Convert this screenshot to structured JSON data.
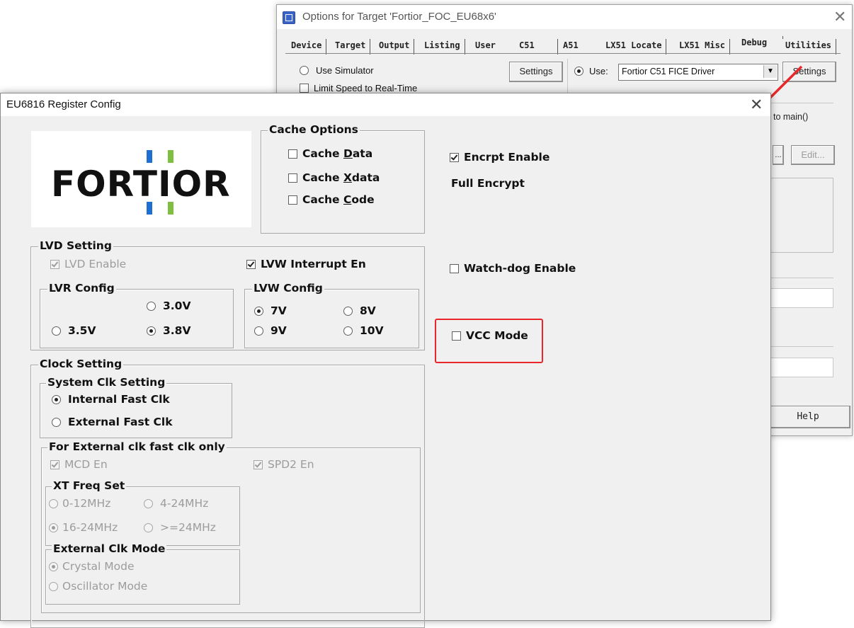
{
  "background_window": {
    "title": "Options for Target 'Fortior_FOC_EU68x6'",
    "tabs": [
      "Device",
      "Target",
      "Output",
      "Listing",
      "User",
      "C51",
      "A51",
      "LX51 Locate",
      "LX51 Misc",
      "Debug",
      "Utilities"
    ],
    "active_tab": "Debug",
    "use_simulator_label": "Use Simulator",
    "limit_speed_label": "Limit Speed to Real-Time",
    "settings_left_label": "Settings",
    "use_label": "Use:",
    "driver_value": "Fortior C51 FICE Driver",
    "settings_right_label": "Settings",
    "run_to_main_fragment": "to main()",
    "edit_label": "Edit...",
    "help_label": "Help"
  },
  "dialog": {
    "title": "EU6816 Register Config",
    "logo_text": "FORTIOR",
    "cache_options": {
      "legend": "Cache Options",
      "cache_data": {
        "pre": "Cache ",
        "u": "D",
        "post": "ata",
        "checked": false
      },
      "cache_xdata": {
        "pre": "Cache ",
        "u": "X",
        "post": "data",
        "checked": false
      },
      "cache_code": {
        "pre": "Cache ",
        "u": "C",
        "post": "ode",
        "checked": false
      }
    },
    "encrypt_enable_label": "Encrpt Enable",
    "full_encrypt_label": "Full Encrypt",
    "watchdog_label": "Watch-dog Enable",
    "vcc_mode_label": "VCC Mode",
    "lvd": {
      "legend": "LVD Setting",
      "lvd_enable_label": "LVD Enable",
      "lvw_interrupt_label": "LVW Interrupt En",
      "lvr_config": {
        "legend": "LVR Config",
        "opt_3_0": "3.0V",
        "opt_3_5": "3.5V",
        "opt_3_8": "3.8V",
        "selected": "3.8V"
      },
      "lvw_config": {
        "legend": "LVW Config",
        "opt_7": "7V",
        "opt_8": "8V",
        "opt_9": "9V",
        "opt_10": "10V",
        "selected": "7V"
      }
    },
    "clock": {
      "legend": "Clock Setting",
      "system_clk": {
        "legend": "System Clk Setting",
        "internal": "Internal Fast Clk",
        "external": "External Fast Clk",
        "selected": "Internal Fast Clk"
      },
      "external_only": {
        "legend": "For External clk fast clk only",
        "mcd_en_label": "MCD En",
        "spd2_en_label": "SPD2 En",
        "xt_freq": {
          "legend": "XT Freq Set",
          "opt1": "0-12MHz",
          "opt2": "4-24MHz",
          "opt3": "16-24MHz",
          "opt4": ">=24MHz",
          "selected": "16-24MHz"
        },
        "ext_clk_mode": {
          "legend": "External Clk Mode",
          "crystal": "Crystal Mode",
          "oscillator": "Oscillator Mode",
          "selected": "Crystal Mode"
        }
      }
    }
  },
  "colors": {
    "highlight": "#e8262b",
    "logo_blue": "#1f6fd1",
    "logo_green": "#7fbf3f"
  }
}
